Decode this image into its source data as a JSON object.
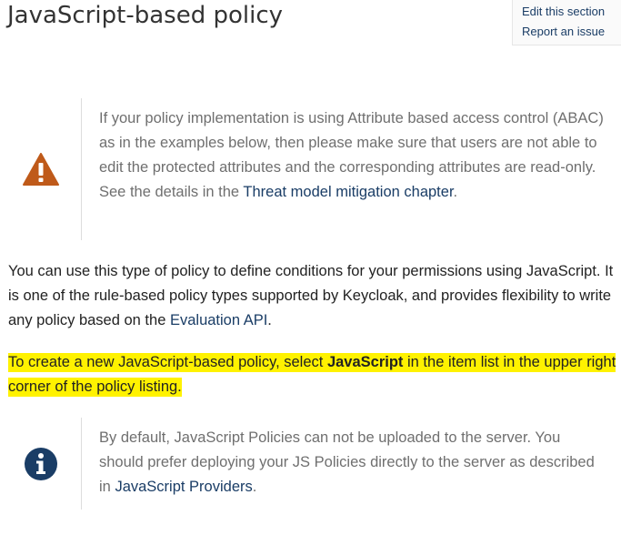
{
  "section": {
    "title": "JavaScript-based policy",
    "edit_links": [
      "Edit this section",
      "Report an issue"
    ]
  },
  "warning": {
    "icon": "warning-icon",
    "icon_color": "#bf5a1a",
    "text_before": "If your policy implementation is using Attribute based access control (ABAC) as in the examples below, then please make sure that users are not able to edit the protected attributes and the corresponding attributes are read-only. See the details in the ",
    "link": "Threat model mitigation chapter",
    "text_after": "."
  },
  "intro": {
    "text_before": "You can use this type of policy to define conditions for your permissions using JavaScript. It is one of the rule-based policy types supported by Keycloak, and provides flexibility to write any policy based on the ",
    "link": "Evaluation API",
    "text_after": "."
  },
  "instruction": {
    "text_before": "To create a new JavaScript-based policy, select ",
    "bold": "JavaScript",
    "text_after": " in the item list in the upper right corner of the policy listing.",
    "highlight_color": "#fff200"
  },
  "note": {
    "icon": "info-icon",
    "icon_color": "#1a3d66",
    "text_before": "By default, JavaScript Policies can not be uploaded to the server. You should prefer deploying your JS Policies directly to the server as described in ",
    "link": "JavaScript Providers",
    "text_after": "."
  }
}
